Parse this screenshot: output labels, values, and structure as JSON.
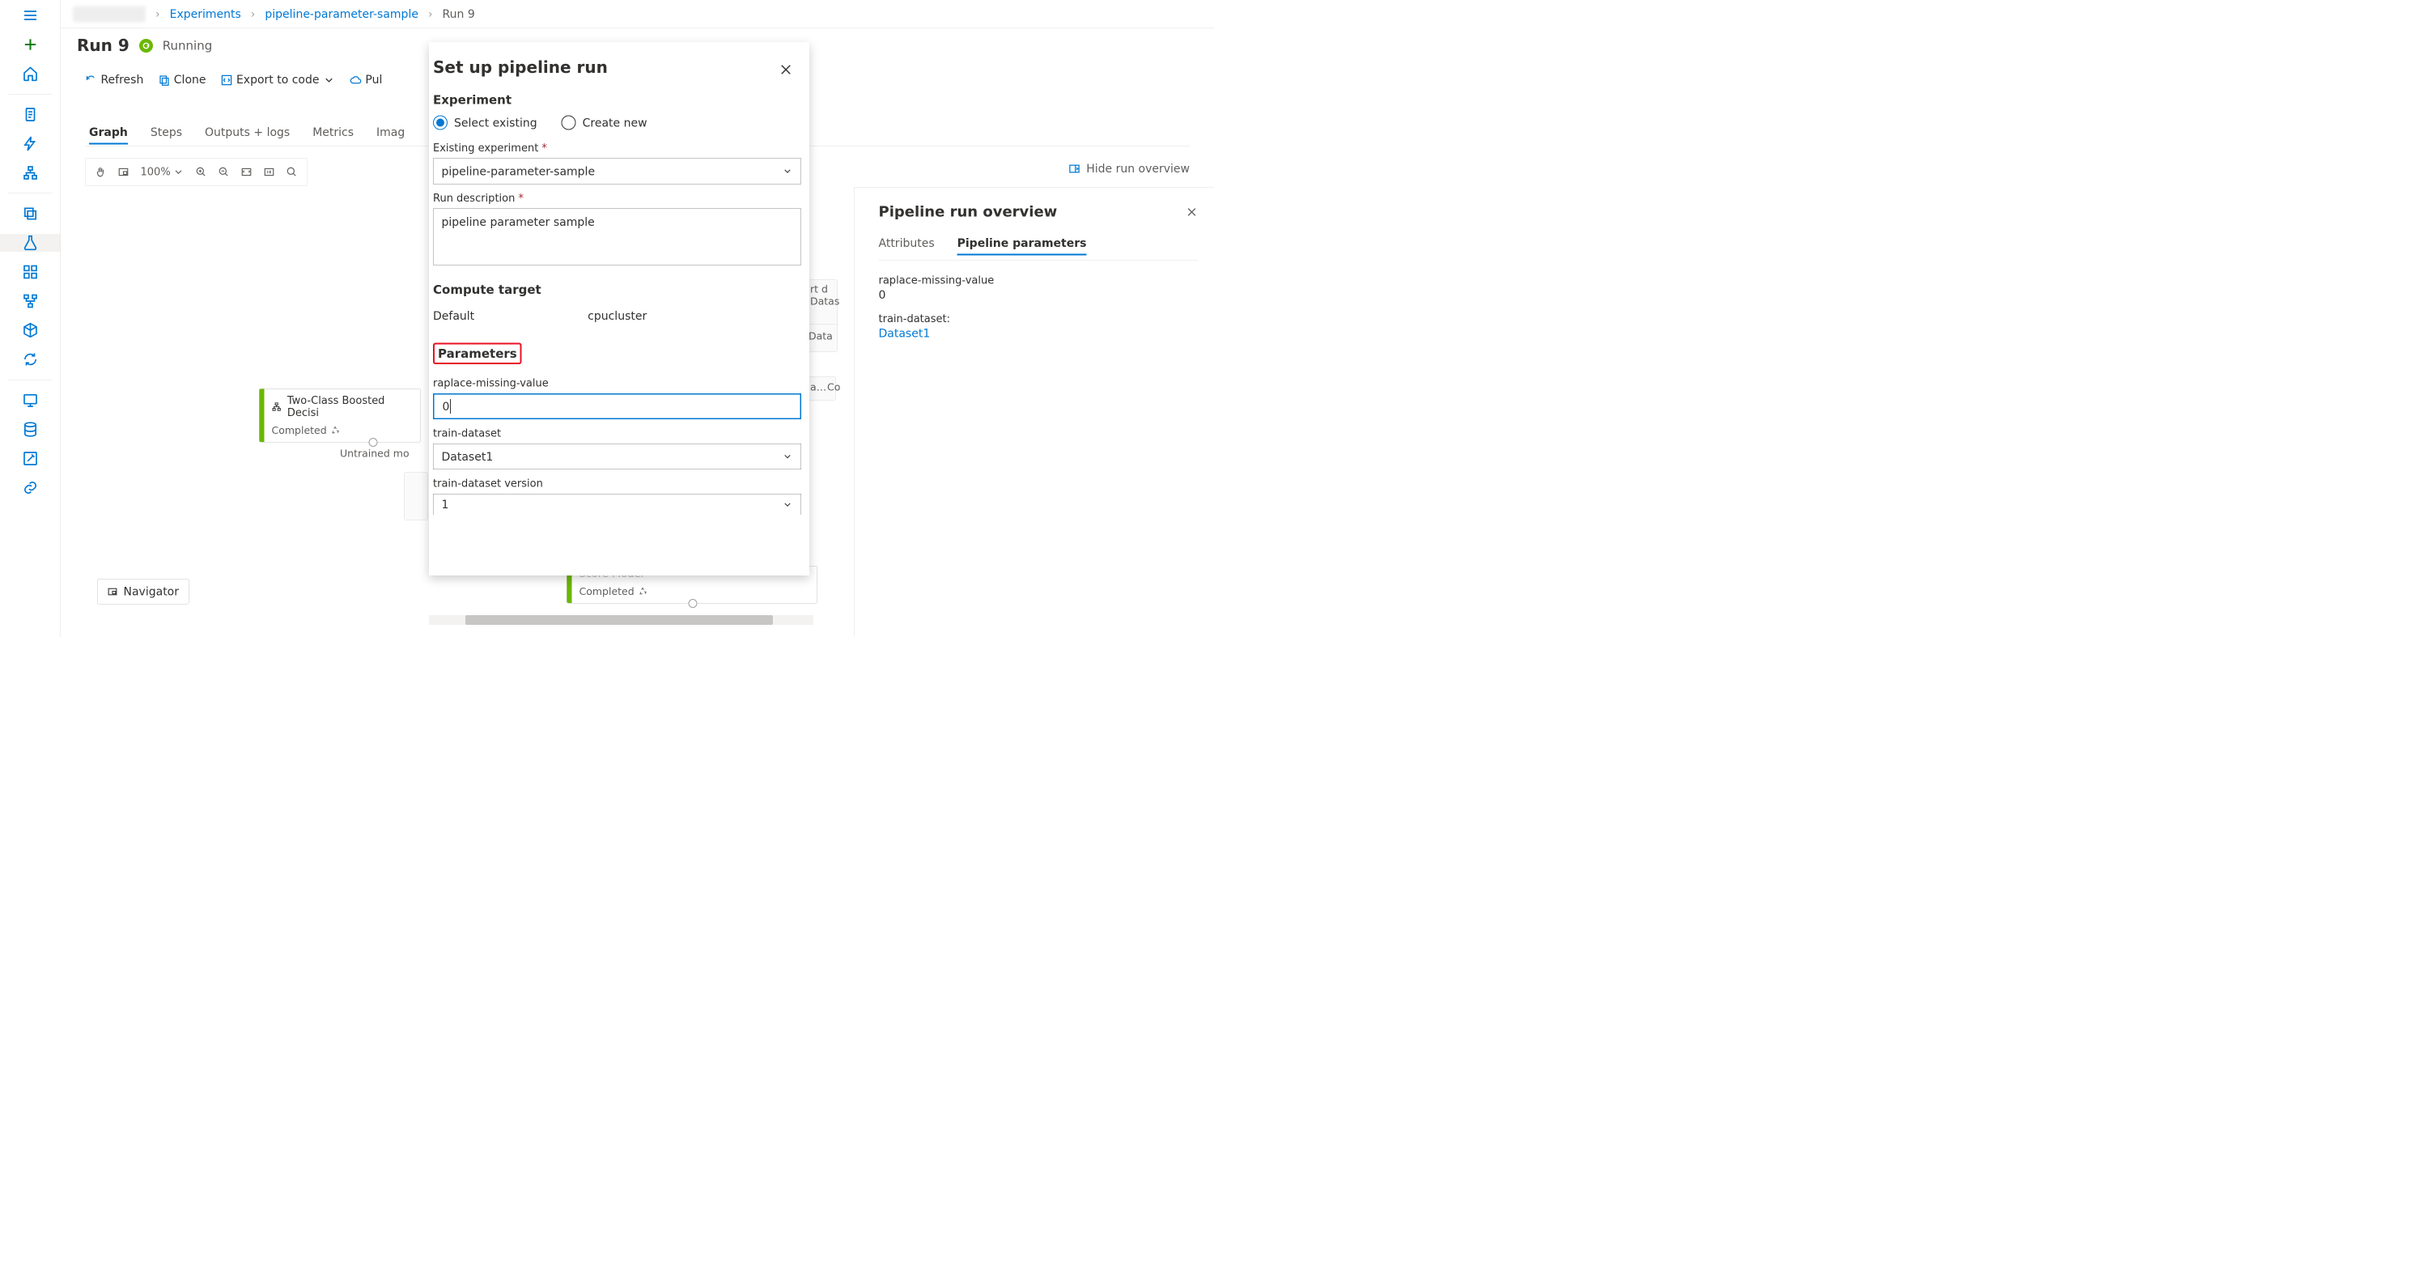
{
  "breadcrumb": {
    "items": [
      {
        "label": "Experiments",
        "link": true
      },
      {
        "label": "pipeline-parameter-sample",
        "link": true
      },
      {
        "label": "Run 9",
        "link": false
      }
    ]
  },
  "header": {
    "title": "Run 9",
    "status": "Running"
  },
  "toolbar": {
    "refresh": "Refresh",
    "clone": "Clone",
    "export": "Export to code",
    "publish": "Pul"
  },
  "tabs": {
    "items": [
      "Graph",
      "Steps",
      "Outputs + logs",
      "Metrics",
      "Imag"
    ],
    "active": 0
  },
  "canvas": {
    "zoom": "100%"
  },
  "hide_overview": "Hide run overview",
  "navigator_label": "Navigator",
  "graph": {
    "node1": {
      "title": "Two-Class Boosted Decisi",
      "status": "Completed"
    },
    "untrained_label": "Untrained mo",
    "node2": {
      "title_stub": "Score Model",
      "status": "Completed"
    },
    "bg_labels": {
      "a": "rt d",
      "b": "Datas",
      "c": "Data",
      "d": "a…",
      "e": "Co"
    }
  },
  "modal": {
    "title": "Set up pipeline run",
    "experiment_header": "Experiment",
    "radio_existing": "Select existing",
    "radio_new": "Create new",
    "existing_label": "Existing experiment",
    "existing_value": "pipeline-parameter-sample",
    "rundesc_label": "Run description",
    "rundesc_value": "pipeline parameter sample",
    "compute_header": "Compute target",
    "compute_default": "Default",
    "compute_value": "cpucluster",
    "params_header": "Parameters",
    "p1_label": "raplace-missing-value",
    "p1_value": "0",
    "p2_label": "train-dataset",
    "p2_value": "Dataset1",
    "p3_label": "train-dataset version",
    "p3_value": "1"
  },
  "overview": {
    "title": "Pipeline run overview",
    "tabs": [
      "Attributes",
      "Pipeline parameters"
    ],
    "active": 1,
    "params": [
      {
        "name": "raplace-missing-value",
        "value": "0",
        "link": false
      },
      {
        "name": "train-dataset:",
        "value": "Dataset1",
        "link": true
      }
    ]
  }
}
